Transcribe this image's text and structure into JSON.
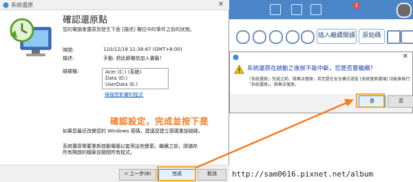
{
  "wizard": {
    "window_title": "系統還原",
    "heading": "確認還原點",
    "subtitle": "您的電腦會還原到發生下面 [描述] 欄位中的事件之前的狀態。",
    "time_label": "時間:",
    "time_value": "110/12/18 11:38:47 (GMT+8:00)",
    "description_label": "描述:",
    "description_value": "手動: 把此節機恰加入書籤！",
    "drives_label": "磁碟機:",
    "drives": [
      "Acer (C:) (系統)",
      "Data (D:)",
      "UserData (E:)"
    ],
    "scan_link": "掃描受影響的程式",
    "password_note": "如果您最近改變您的 Windows 密碼，建議您建立密碼重設磁碟。",
    "restart_note": "系統還原需要重新啟動電腦以套用這些變更。繼續之前，請儲存所有開啟的檔案並關閉所有程式。",
    "back_button": "< 上一步(B)",
    "finish_button": "完成",
    "cancel_button": "取消"
  },
  "annotation": "確認設定，完成並按下是",
  "confirm_dialog": {
    "message": "系統還原在啟動之後就不能中斷，您是否要繼續?",
    "detail": "「系統還原」完成之前，將無法復原，若您是在安全模式或從 [系統復原選項] 功能表執行「系統還原」，將無法復原。",
    "yes_button": "是",
    "no_button": "否"
  },
  "background_app": {
    "insert_button": "插入繼續閱讀",
    "source_button": "原始碼",
    "notification_count": "2"
  },
  "watermark": "http://sam0616.pixnet.net/album",
  "colors": {
    "annotation": "#f47a20",
    "highlight_box": "#f5a623",
    "dialog_message": "#1a3fb0",
    "link": "#1f5ec9",
    "app_header": "#4a86c8"
  }
}
